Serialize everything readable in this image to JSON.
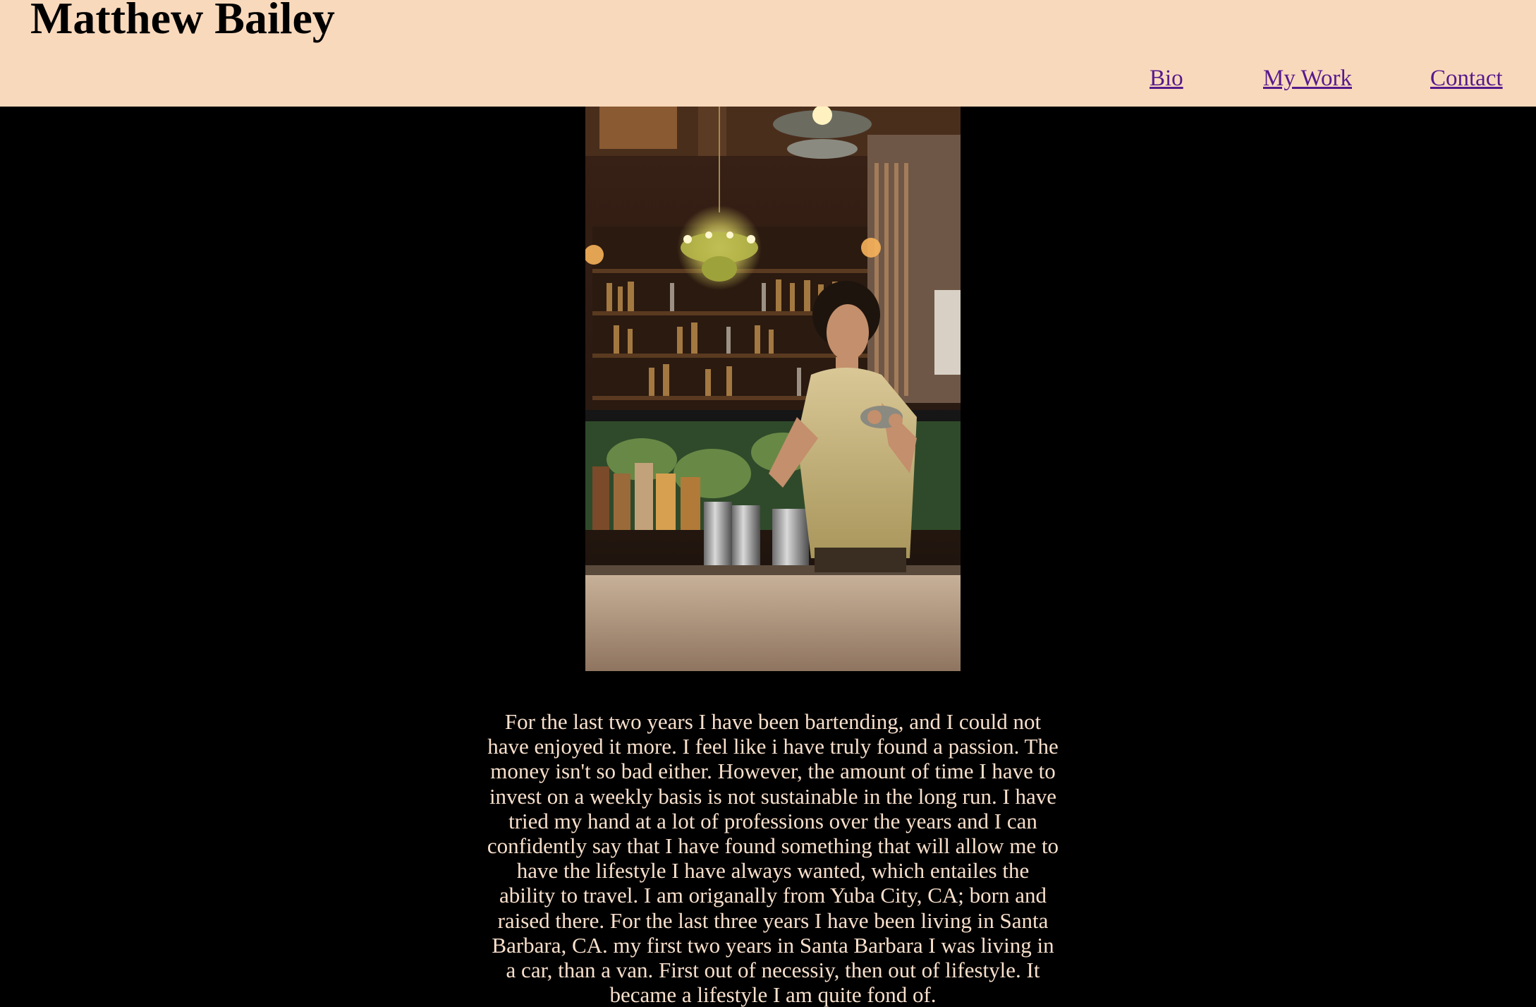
{
  "header": {
    "title": "Matthew Bailey",
    "background": "#f9d9bc"
  },
  "nav": {
    "items": [
      {
        "label": "Bio"
      },
      {
        "label": "My Work"
      },
      {
        "label": "Contact"
      }
    ],
    "link_color": "#551a8b"
  },
  "photo": {
    "icon": "bartender-photo"
  },
  "bio": {
    "text": "For the last two years I have been bartending, and I could not have enjoyed it more. I feel like i have truly found a passion. The money isn't so bad either. However, the amount of time I have to invest on a weekly basis is not sustainable in the long run. I have tried my hand at a lot of professions over the years and I can confidently say that I have found something that will allow me to have the lifestyle I have always wanted, which entailes the ability to travel. I am origanally from Yuba City, CA; born and raised there. For the last three years I have been living in Santa Barbara, CA. my first two years in Santa Barbara I was living in a car, than a van. First out of necessiy, then out of lifestyle. It became a lifestyle I am quite fond of.",
    "color": "#f9e0cc"
  },
  "page": {
    "background": "#000000"
  }
}
